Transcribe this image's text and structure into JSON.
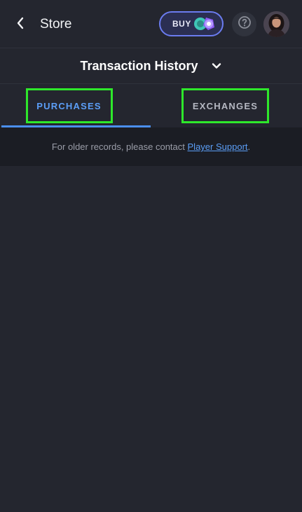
{
  "header": {
    "back_icon": "chevron-left-icon",
    "title": "Store",
    "buy_label": "BUY",
    "coin_icon": "currency-coins-icon",
    "help_icon": "question-circle-icon",
    "avatar": "user-avatar"
  },
  "page": {
    "title": "Transaction History",
    "chevron_icon": "chevron-down-icon"
  },
  "tabs": [
    {
      "label": "PURCHASES",
      "active": true
    },
    {
      "label": "EXCHANGES",
      "active": false
    }
  ],
  "notice": {
    "text": "For older records, please contact ",
    "link_label": "Player Support",
    "suffix": "."
  },
  "colors": {
    "background": "#24262f",
    "accent": "#5b9ef7",
    "highlight_box": "#2ee82b"
  }
}
